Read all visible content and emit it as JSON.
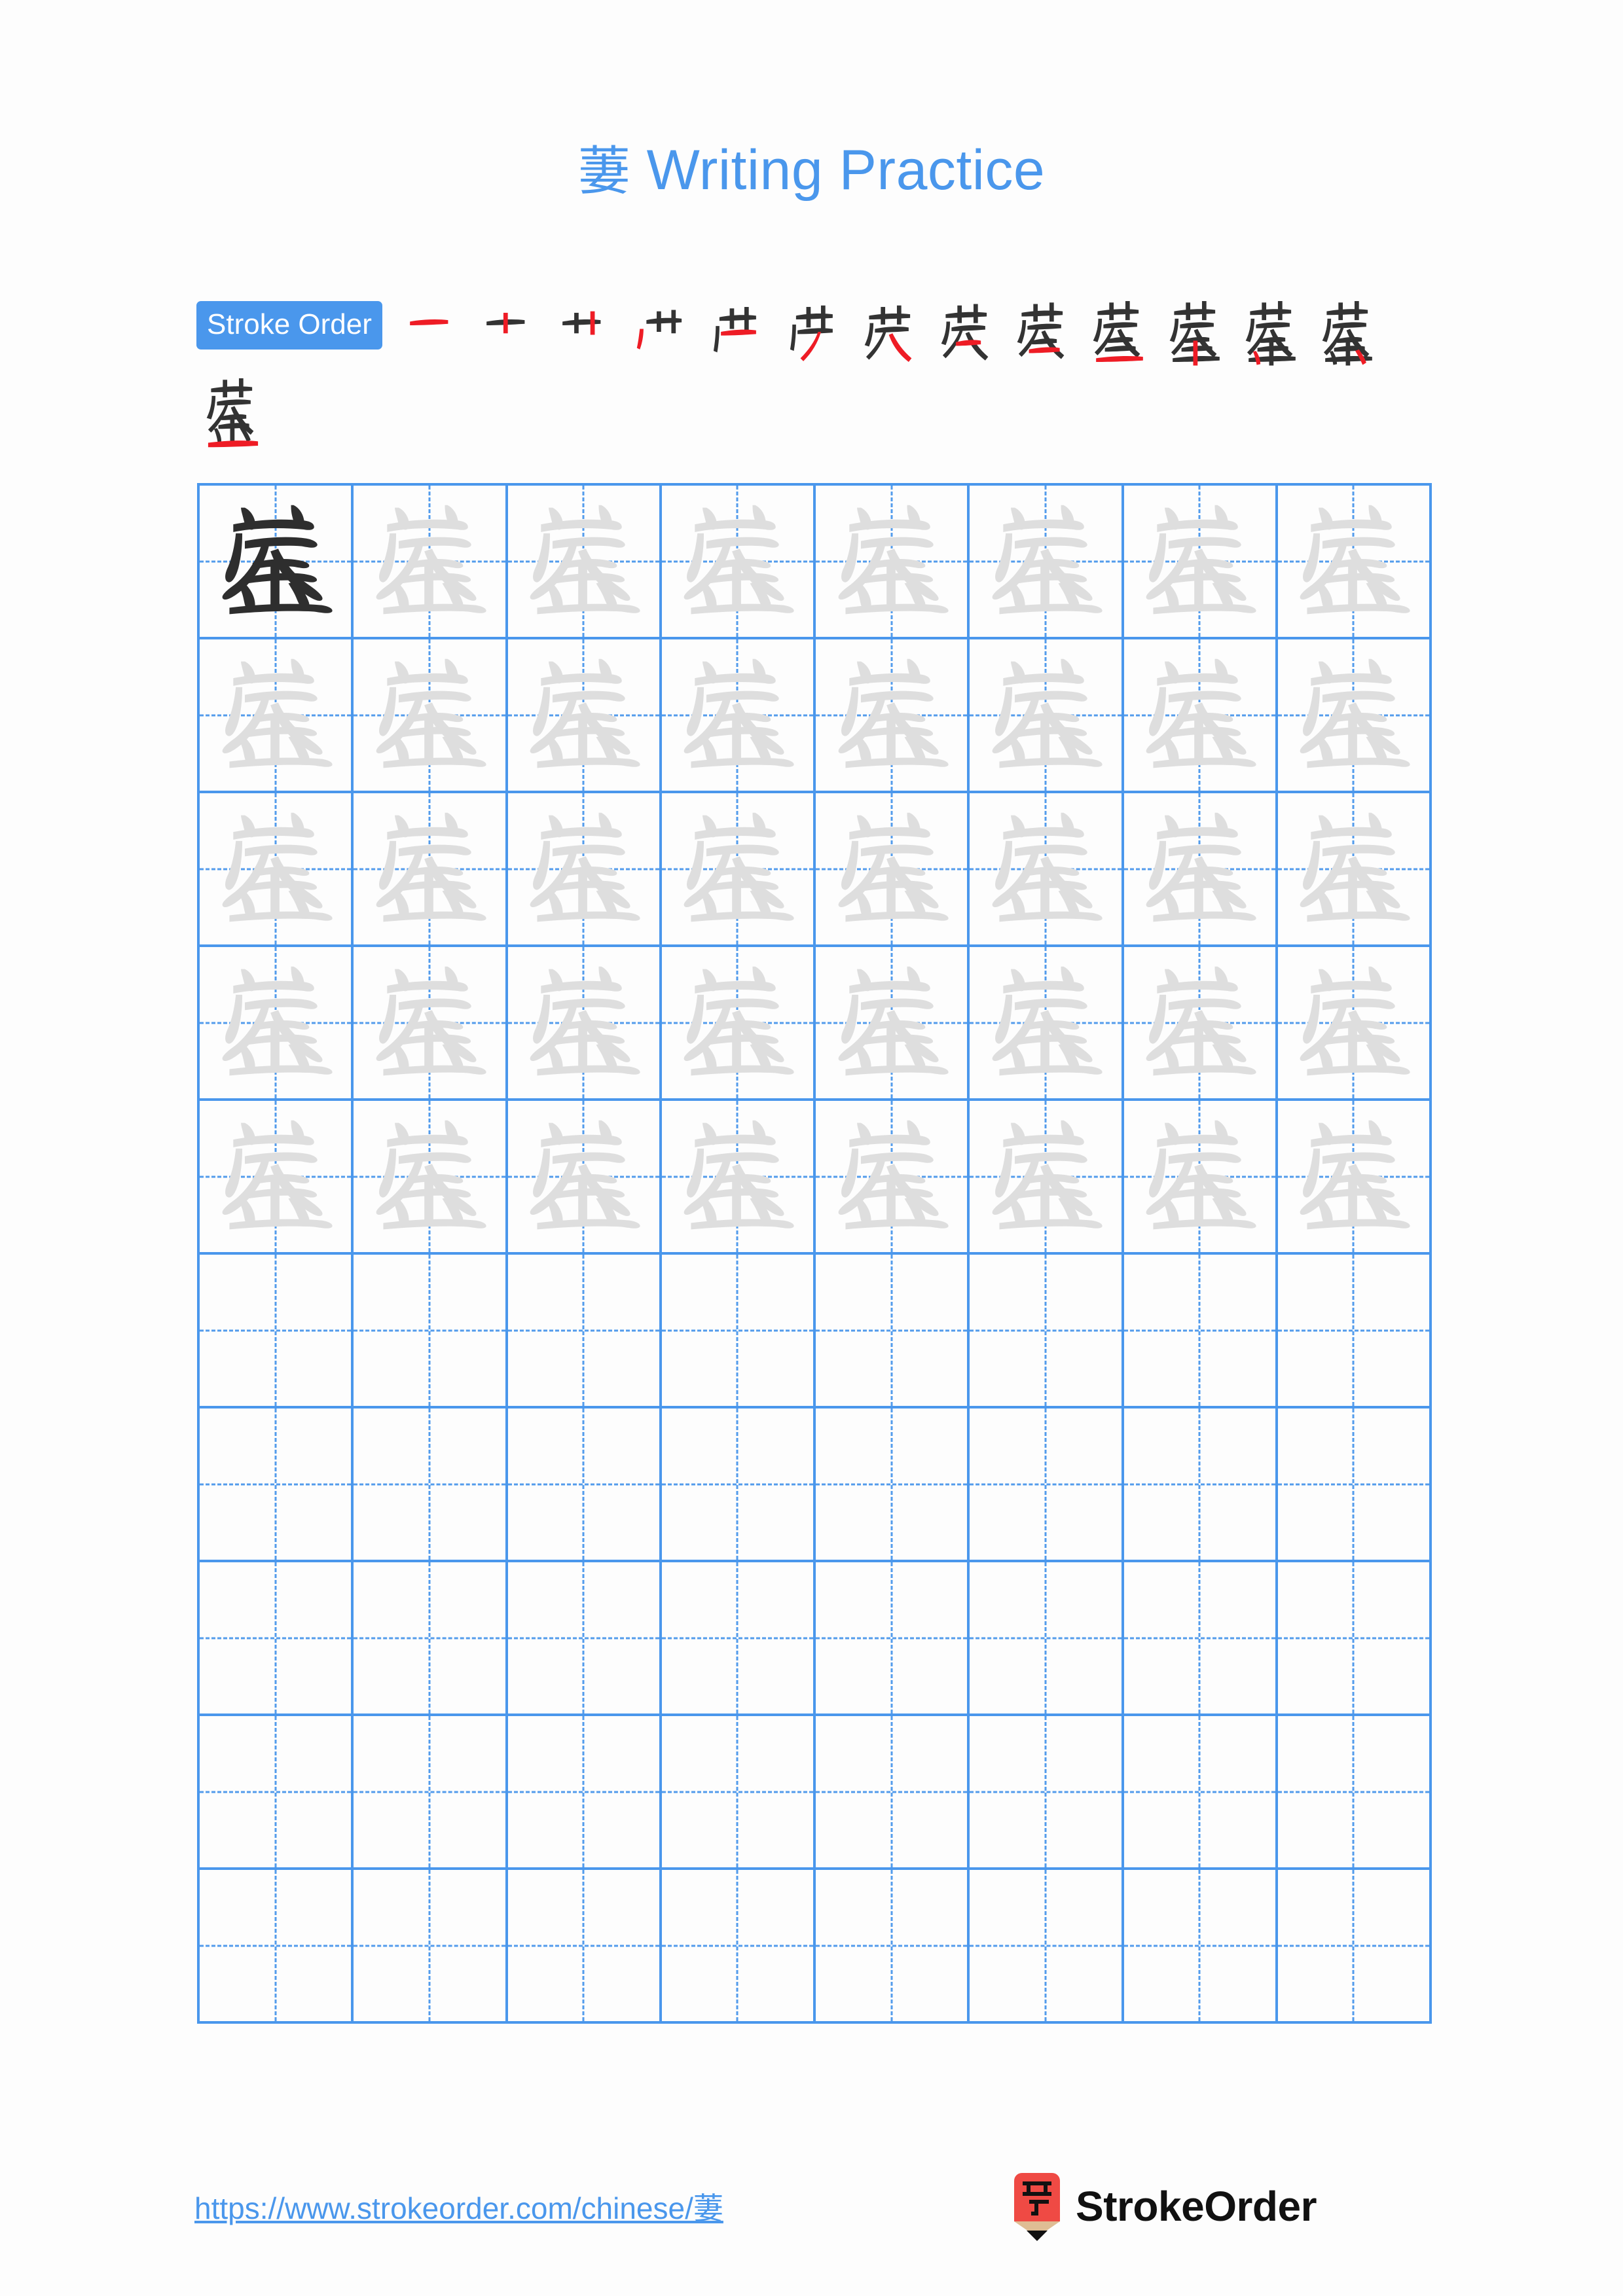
{
  "page": {
    "background_color": "#fdfdfd",
    "accent_color": "#4a97ec",
    "ink_color": "#2e2e2e",
    "trace_color": "#dedede",
    "highlight_color": "#ee1c25"
  },
  "header": {
    "character": "萋",
    "title_suffix": " Writing Practice",
    "title_full": "萋 Writing Practice"
  },
  "stroke_order": {
    "badge_label": "Stroke Order",
    "character": "萋",
    "total_strokes": 14,
    "row1_count": 13,
    "row2_count": 1,
    "steps": [
      {
        "index": 1,
        "partial": "一"
      },
      {
        "index": 2,
        "partial": "十"
      },
      {
        "index": 3,
        "partial": "艹"
      },
      {
        "index": 4,
        "partial": "艹"
      },
      {
        "index": 5,
        "partial": "芦"
      },
      {
        "index": 6,
        "partial": "芀"
      },
      {
        "index": 7,
        "partial": "芖"
      },
      {
        "index": 8,
        "partial": "芡"
      },
      {
        "index": 9,
        "partial": "荽"
      },
      {
        "index": 10,
        "partial": "萃"
      },
      {
        "index": 11,
        "partial": "萃"
      },
      {
        "index": 12,
        "partial": "萋"
      },
      {
        "index": 13,
        "partial": "萋"
      },
      {
        "index": 14,
        "partial": "萋"
      }
    ]
  },
  "practice_grid": {
    "columns": 8,
    "rows": 10,
    "filled_rows": 5,
    "blank_rows": 5,
    "model_cell": {
      "row": 1,
      "column": 1,
      "style": "dark"
    },
    "character": "萋"
  },
  "footer": {
    "url": "https://www.strokeorder.com/chinese/萋",
    "brand_name": "StrokeOrder",
    "logo_character": "字",
    "logo_body_color": "#ef4a44",
    "logo_wood_color": "#dfbd94",
    "logo_tip_color": "#111111"
  }
}
